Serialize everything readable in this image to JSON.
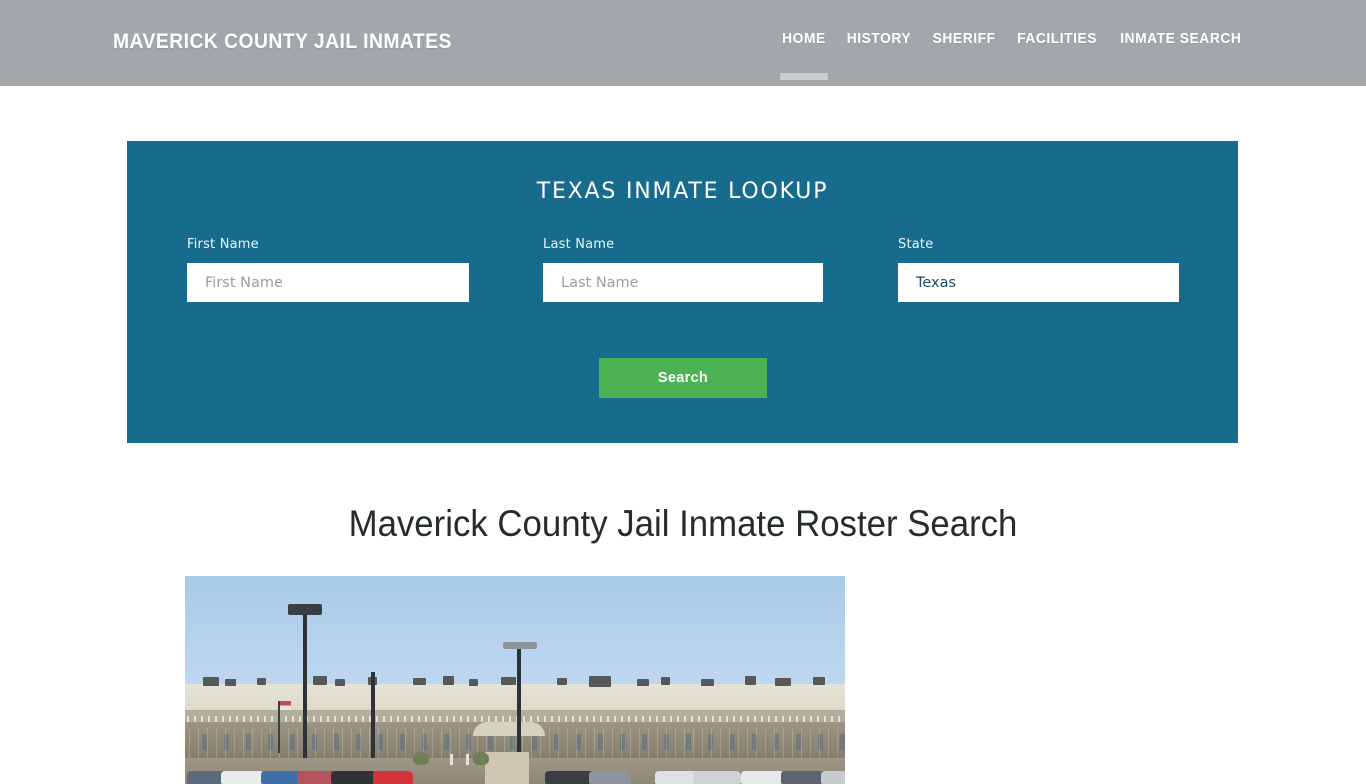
{
  "header": {
    "brand": "MAVERICK COUNTY JAIL INMATES",
    "nav": [
      {
        "label": "HOME",
        "active": true
      },
      {
        "label": "HISTORY",
        "active": false
      },
      {
        "label": "SHERIFF",
        "active": false
      },
      {
        "label": "FACILITIES",
        "active": false
      },
      {
        "label": "INMATE SEARCH",
        "active": false
      }
    ],
    "background_color": "#a2a7ab",
    "text_color": "#ffffff",
    "active_indicator_color": "#c9ced1"
  },
  "lookup": {
    "title": "TEXAS INMATE LOOKUP",
    "panel_color": "#176c8e",
    "fields": {
      "first_name": {
        "label": "First Name",
        "placeholder": "First Name",
        "value": ""
      },
      "last_name": {
        "label": "Last Name",
        "placeholder": "Last Name",
        "value": ""
      },
      "state": {
        "label": "State",
        "value": "Texas",
        "options": [
          "Texas"
        ]
      }
    },
    "search_button": {
      "label": "Search",
      "color": "#4cb254"
    }
  },
  "article": {
    "heading": "Maverick County Jail Inmate Roster Search",
    "photo_alt": "Maverick County Jail facility exterior with perimeter fence and parking lot"
  }
}
